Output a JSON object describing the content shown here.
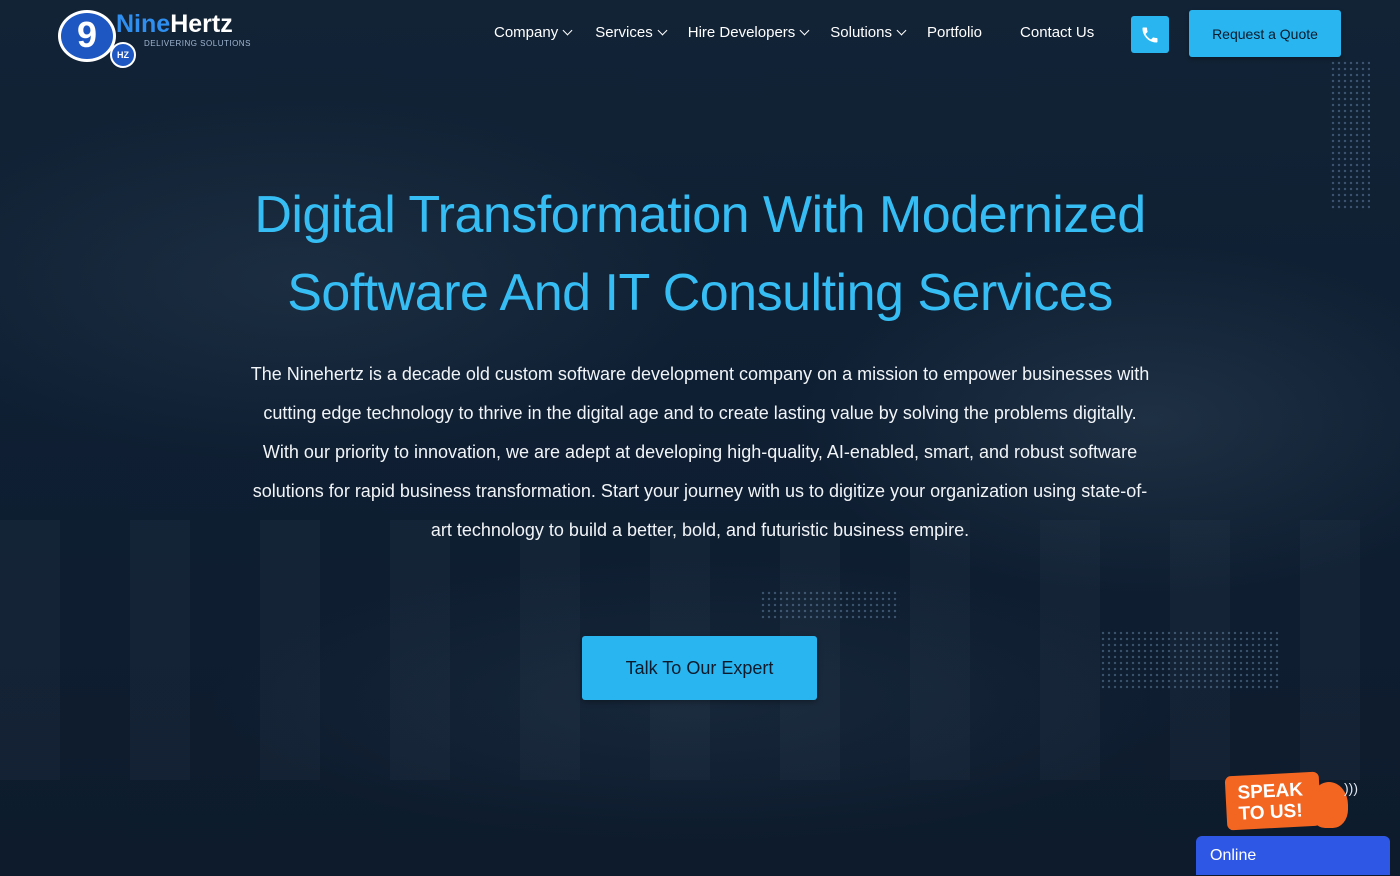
{
  "brand": {
    "mark": "9",
    "hz": "HZ",
    "name_part1": "Nine",
    "name_part2": "Hertz",
    "tagline": "DELIVERING SOLUTIONS"
  },
  "nav": {
    "items": [
      {
        "label": "Company",
        "dropdown": true
      },
      {
        "label": "Services",
        "dropdown": true
      },
      {
        "label": "Hire Developers",
        "dropdown": true
      },
      {
        "label": "Solutions",
        "dropdown": true
      },
      {
        "label": "Portfolio",
        "dropdown": false
      },
      {
        "label": "Contact Us",
        "dropdown": false
      }
    ],
    "phone_icon": "phone-icon",
    "quote_label": "Request a Quote"
  },
  "hero": {
    "title_line1": "Digital Transformation With Modernized",
    "title_line2": "Software And IT Consulting Services",
    "description": "The Ninehertz is a decade old custom software development company on a mission to empower businesses with cutting edge technology to thrive in the digital age and to create lasting value by solving the problems digitally. With our priority to innovation, we are adept at developing high-quality, AI-enabled, smart, and robust software solutions for rapid business transformation. Start your journey with us to digitize your organization using state-of-art technology to build a better, bold, and futuristic business empire.",
    "cta_label": "Talk To Our Expert"
  },
  "widgets": {
    "speak_line1": "SPEAK",
    "speak_line2": "TO US!",
    "chat_status": "Online"
  },
  "colors": {
    "accent": "#29b6f0",
    "title": "#36bef4",
    "background": "#0c1a2b",
    "speak_orange": "#f26622",
    "chat_blue": "#2f57e5"
  }
}
